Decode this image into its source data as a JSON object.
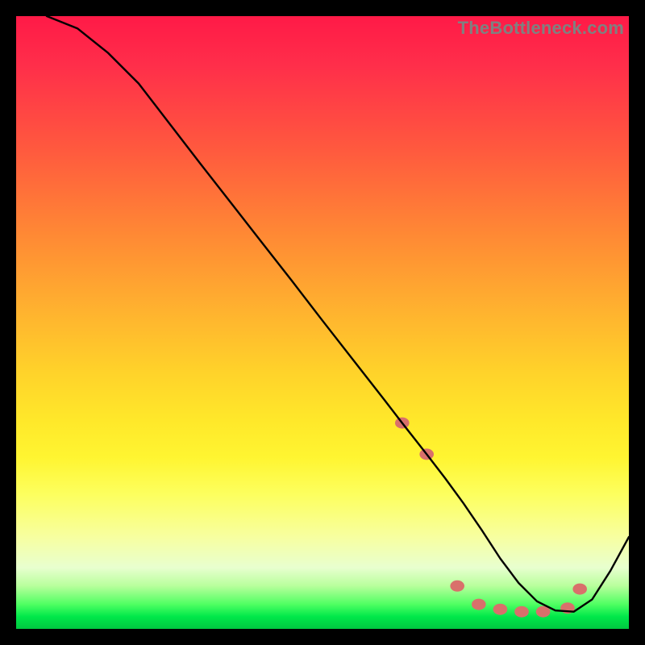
{
  "watermark": "TheBottleneck.com",
  "chart_data": {
    "type": "line",
    "title": "",
    "xlabel": "",
    "ylabel": "",
    "xlim": [
      0,
      100
    ],
    "ylim": [
      0,
      100
    ],
    "grid": false,
    "legend": false,
    "background_gradient": {
      "top": "#ff1a47",
      "mid": "#ffe82a",
      "bottom": "#00c840"
    },
    "series": [
      {
        "name": "bottleneck-curve",
        "color": "#000000",
        "x": [
          5,
          10,
          15,
          20,
          25,
          30,
          35,
          40,
          45,
          50,
          55,
          60,
          63,
          67,
          70,
          73,
          76,
          79,
          82,
          85,
          88,
          91,
          94,
          97,
          100
        ],
        "y": [
          100,
          98,
          94,
          89,
          82.5,
          76,
          69.6,
          63.2,
          56.8,
          50.3,
          43.9,
          37.5,
          33.6,
          28.5,
          24.6,
          20.5,
          16.1,
          11.5,
          7.5,
          4.5,
          3.0,
          2.8,
          4.8,
          9.5,
          15
        ]
      }
    ],
    "markers": {
      "name": "highlight-dots",
      "color": "#d9706b",
      "radius": 7,
      "x": [
        63,
        67,
        72,
        75.5,
        79,
        82.5,
        86,
        90,
        92
      ],
      "y": [
        33.6,
        28.5,
        7.0,
        4.0,
        3.2,
        2.8,
        2.8,
        3.4,
        6.5
      ]
    }
  }
}
